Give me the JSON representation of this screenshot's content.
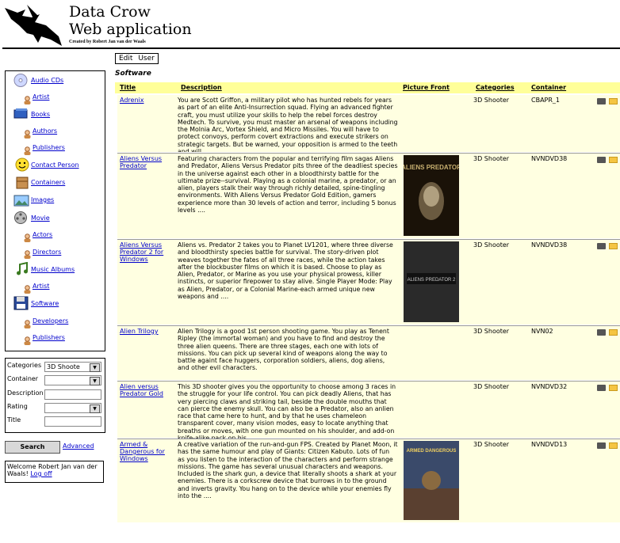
{
  "app": {
    "title_line1": "Data Crow",
    "title_line2": "Web application",
    "credit": "Created by Robert Jan van der Waals"
  },
  "menu": {
    "edit": "Edit",
    "user": "User"
  },
  "nav": {
    "audio_cds": "Audio CDs",
    "audio_artist": "Artist",
    "books": "Books",
    "authors": "Authors",
    "publishers": "Publishers",
    "contact_person": "Contact Person",
    "containers": "Containers",
    "images": "Images",
    "movie": "Movie",
    "actors": "Actors",
    "directors": "Directors",
    "music_albums": "Music Albums",
    "music_artist": "Artist",
    "software": "Software",
    "developers": "Developers",
    "software_publishers": "Publishers"
  },
  "filter": {
    "categories_label": "Categories",
    "categories_value": "3D Shoote",
    "container_label": "Container",
    "description_label": "Description",
    "rating_label": "Rating",
    "title_label": "Title"
  },
  "search_label": "Search",
  "advanced_label": "Advanced",
  "welcome_text": "Welcome Robert Jan van der Waals!",
  "logoff_label": "Log off",
  "section_title": "Software",
  "columns": {
    "title": "Title",
    "description": "Description",
    "picture": "Picture Front",
    "categories": "Categories",
    "container": "Container"
  },
  "rows": [
    {
      "title": "Adrenix",
      "description": "You are Scott Griffon, a military pilot who has hunted rebels for years as part of an elite Anti-Insurrection squad. Flying an advanced fighter craft, you must utilize your skills to help the rebel forces destroy Medtech. To survive, you must master an arsenal of weapons including the Molnia Arc, Vortex Shield, and Micro Missiles. You will have to protect convoys, perform covert extractions and execute strikers on strategic targets. But be warned, your opposition is armed to the teeth and will ....",
      "category": "3D Shooter",
      "container": "CBAPR_1"
    },
    {
      "title": "Aliens Versus Predator",
      "description": "Featuring characters from the popular and terrifying film sagas Aliens and Predator, Aliens Versus Predator pits three of the deadliest species in the universe against each other in a bloodthirsty battle for the ultimate prize--survival. Playing as a colonial marine, a predator, or an alien, players stalk their way through richly detailed, spine-tingling environments. With Aliens Versus Predator Gold Edition, gamers experience more than 30 levels of action and terror, including 5 bonus levels ....",
      "category": "3D Shooter",
      "container": "NVNDVD38"
    },
    {
      "title": "Aliens Versus Predator 2 for Windows",
      "description": "Aliens vs. Predator 2 takes you to Planet LV1201, where three diverse and bloodthirsty species battle for survival. The story-driven plot weaves together the fates of all three races, while the action takes after the blockbuster films on which it is based. Choose to play as Alien, Predator, or Marine as you use your physical prowess, killer instincts, or superior firepower to stay alive. Single Player Mode: Play as Alien, Predator, or a Colonial Marine-each armed unique new weapons and ....",
      "category": "3D Shooter",
      "container": "NVNDVD38"
    },
    {
      "title": "Alien Trilogy",
      "description": "Alien Trilogy is a good 1st person shooting game. You play as Tenent Ripley (the immortal woman) and you have to find and destroy the three alien queens. There are three stages, each one with lots of missions. You can pick up several kind of weapons along the way to battle againt face huggers, corporation soldiers, aliens, dog aliens, and other evil characters.",
      "category": "3D Shooter",
      "container": "NVN02"
    },
    {
      "title": "Alien versus Predator Gold",
      "description": "This 3D shooter gives you the opportunity to choose among 3 races in the struggle for your life control. You can pick deadly Aliens, that has very piercing claws and striking tail, beside the double mouths that can pierce the enemy skull. You can also be a Predator, also an anlien race that came here to hunt, and by that he uses chameleon transparent cover, many vision modes, easy to locate anything that breaths or moves, with one gun mounted on his shoulder, and add-on knife-alike pack on his ....",
      "category": "3D Shooter",
      "container": "NVNDVD32"
    },
    {
      "title": "Armed & Dangerous for Windows",
      "description": "A creative variation of the run-and-gun FPS. Created by Planet Moon, it has the same humour and play of Giants: Citizen Kabuto. Lots of fun as you listen to the interaction of the characters and perform strange missions. The game has several unusual characters and weapons. Included is the shark gun, a device that literally shoots a shark at your enemies. There is a corkscrew device that burrows in to the ground and inverts gravity. You hang on to the device while your enemies fly into the ....",
      "category": "3D Shooter",
      "container": "NVNDVD13"
    }
  ],
  "covers": {
    "avp_1": "ALIENS PREDATOR",
    "avp_2": "ALIENS PREDATOR 2",
    "armed": "ARMED DANGEROUS"
  }
}
